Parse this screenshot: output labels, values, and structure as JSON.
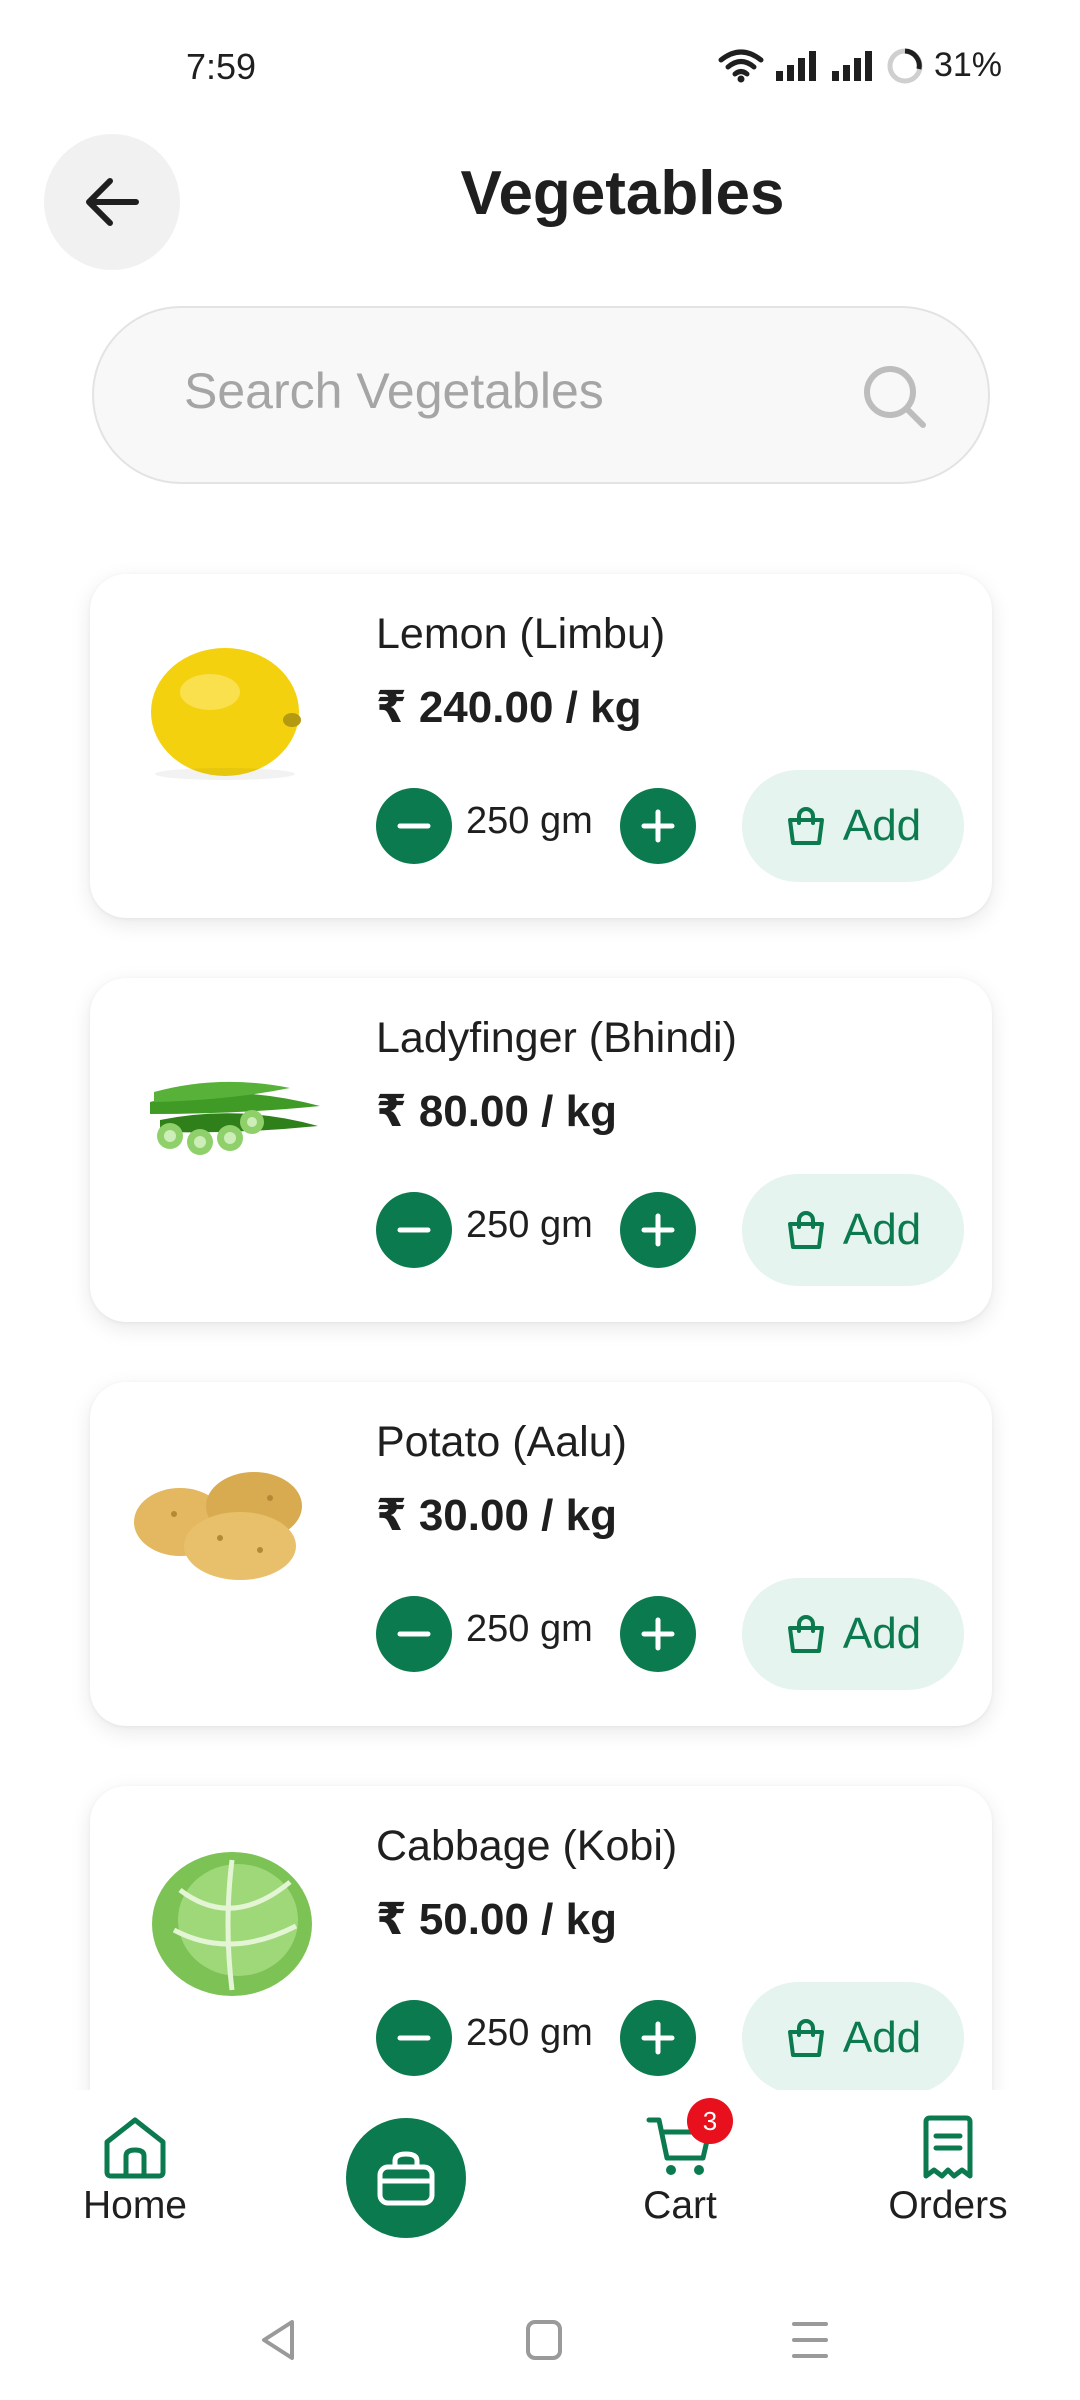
{
  "status_bar": {
    "time": "7:59",
    "battery": "31%"
  },
  "header": {
    "title": "Vegetables"
  },
  "search": {
    "placeholder": "Search Vegetables"
  },
  "products": [
    {
      "name": "Lemon (Limbu)",
      "price": "₹ 240.00 / kg",
      "quantity": "250 gm",
      "add_label": "Add",
      "image": "lemon"
    },
    {
      "name": "Ladyfinger (Bhindi)",
      "price": "₹ 80.00 / kg",
      "quantity": "250 gm",
      "add_label": "Add",
      "image": "okra"
    },
    {
      "name": "Potato (Aalu)",
      "price": "₹ 30.00 / kg",
      "quantity": "250 gm",
      "add_label": "Add",
      "image": "potato"
    },
    {
      "name": "Cabbage (Kobi)",
      "price": "₹ 50.00 / kg",
      "quantity": "250 gm",
      "add_label": "Add",
      "image": "cabbage"
    }
  ],
  "bottom_nav": {
    "home_label": "Home",
    "cart_label": "Cart",
    "cart_badge": "3",
    "orders_label": "Orders"
  },
  "colors": {
    "brand_green": "#0b7a4f",
    "add_bg": "#e5f4ee",
    "badge_red": "#e8101c"
  }
}
